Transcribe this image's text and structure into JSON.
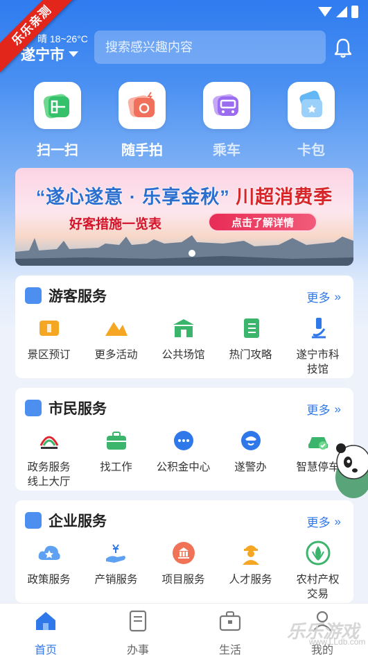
{
  "header": {
    "corner_badge": "乐乐亲测",
    "weather": "晴 18~26°C",
    "city": "遂宁市",
    "search_placeholder": "搜索感兴趣内容"
  },
  "quick_actions": [
    {
      "label": "扫一扫",
      "icon": "scan-icon"
    },
    {
      "label": "随手拍",
      "icon": "camera-icon"
    },
    {
      "label": "乘车",
      "icon": "bus-icon"
    },
    {
      "label": "卡包",
      "icon": "card-wallet-icon"
    }
  ],
  "banner": {
    "title_a": "“遂心遂意 · 乐享金秋”",
    "title_b": "川超消费季",
    "subtitle": "好客措施一览表",
    "button": "点击了解详情"
  },
  "tourist": {
    "title": "游客服务",
    "more": "更多",
    "items": [
      {
        "label": "景区预订",
        "icon": "ticket-icon",
        "color": "#f5a623"
      },
      {
        "label": "更多活动",
        "icon": "mountain-icon",
        "color": "#f5a623"
      },
      {
        "label": "公共场馆",
        "icon": "gate-icon",
        "color": "#3bb56b"
      },
      {
        "label": "热门攻略",
        "icon": "notebook-icon",
        "color": "#3bb56b"
      },
      {
        "label": "遂宁市科技馆",
        "icon": "microscope-icon",
        "color": "#2f78ea"
      }
    ]
  },
  "citizen": {
    "title": "市民服务",
    "more": "更多",
    "items": [
      {
        "label": "政务服务线上大厅",
        "icon": "gov-logo-icon",
        "color": "#e0262f"
      },
      {
        "label": "找工作",
        "icon": "briefcase-icon",
        "color": "#3bb56b"
      },
      {
        "label": "公积金中心",
        "icon": "chat-dots-icon",
        "color": "#2f78ea"
      },
      {
        "label": "遂警办",
        "icon": "police-icon",
        "color": "#2f78ea"
      },
      {
        "label": "智慧停车",
        "icon": "car-icon",
        "color": "#3bb56b"
      }
    ]
  },
  "enterprise": {
    "title": "企业服务",
    "more": "更多",
    "items": [
      {
        "label": "政策服务",
        "icon": "cloud-star-icon",
        "color": "#2f78ea"
      },
      {
        "label": "产销服务",
        "icon": "hand-yuan-icon",
        "color": "#2f78ea"
      },
      {
        "label": "项目服务",
        "icon": "bank-icon",
        "color": "#f07357"
      },
      {
        "label": "人才服务",
        "icon": "worker-icon",
        "color": "#f5a623"
      },
      {
        "label": "农村产权交易",
        "icon": "rural-logo-icon",
        "color": "#3bb56b"
      }
    ]
  },
  "tabbar": [
    {
      "label": "首页",
      "icon": "home-icon",
      "active": true
    },
    {
      "label": "办事",
      "icon": "document-icon",
      "active": false
    },
    {
      "label": "生活",
      "icon": "briefcase-icon",
      "active": false
    },
    {
      "label": "我的",
      "icon": "user-icon",
      "active": false
    }
  ],
  "watermark": {
    "text": "乐乐游戏",
    "url": "www.LLdb.com"
  }
}
